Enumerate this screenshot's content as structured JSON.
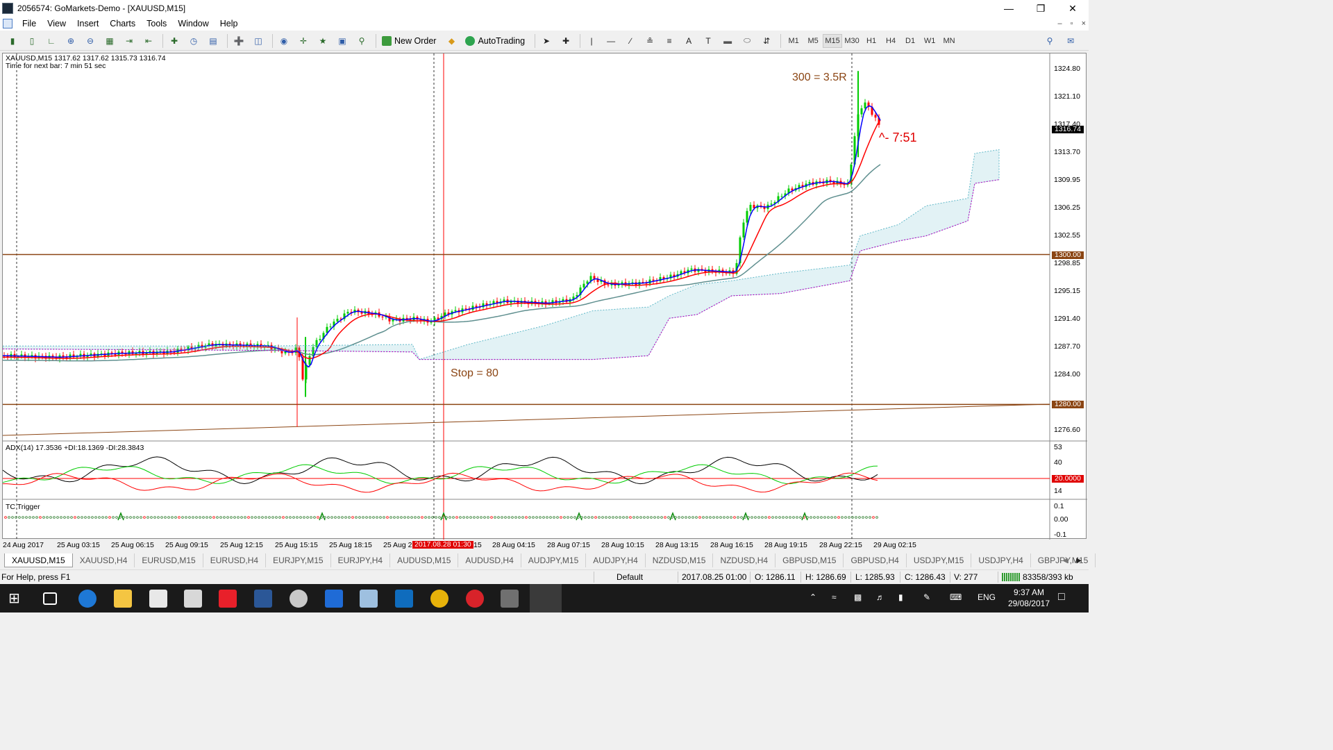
{
  "window": {
    "title": "2056574: GoMarkets-Demo - [XAUUSD,M15]",
    "minimize": "—",
    "restore": "❐",
    "close": "✕"
  },
  "menu": [
    "File",
    "Insert",
    "Charts",
    "Tools",
    "Window",
    "Help"
  ],
  "menu_view": "View",
  "toolbar": {
    "new_order": "New Order",
    "autotrading": "AutoTrading",
    "timeframes": [
      "M1",
      "M5",
      "M15",
      "M30",
      "H1",
      "H4",
      "D1",
      "W1",
      "MN"
    ],
    "active_timeframe": "M15"
  },
  "chart": {
    "info": "XAUUSD,M15  1317.62 1317.62 1315.73 1316.74",
    "timer": "Time for next bar: 7 min 51 sec",
    "annotation_target": "300 = 3.5R",
    "annotation_stop": "Stop = 80",
    "annotation_time": "^- 7:51",
    "current_price": "1316.74",
    "level_high": "1300.00",
    "level_low": "1280.00",
    "price_labels": [
      "1324.80",
      "1321.10",
      "1317.40",
      "1313.70",
      "1309.95",
      "1306.25",
      "1302.55",
      "1298.85",
      "1295.15",
      "1291.40",
      "1287.70",
      "1284.00",
      "1276.60"
    ],
    "time_labels": [
      "24 Aug 2017",
      "25 Aug 03:15",
      "25 Aug 06:15",
      "25 Aug 09:15",
      "25 Aug 12:15",
      "25 Aug 15:15",
      "25 Aug 18:15",
      "25 Aug 2",
      "15",
      "28 Aug 04:15",
      "28 Aug 07:15",
      "28 Aug 10:15",
      "28 Aug 13:15",
      "28 Aug 16:15",
      "28 Aug 19:15",
      "28 Aug 22:15",
      "29 Aug 02:15"
    ],
    "cursor_time": "2017.08.28 01:30",
    "colors": {
      "bull": "#00cc00",
      "bear": "#ff0000",
      "level": "#8b4513",
      "fast_ma": "#0000ff",
      "mid_ma": "#ff0000",
      "slow_ma": "#5f8f8f",
      "cloud": "#5fb8c8",
      "cloud_edge": "#c000c0"
    }
  },
  "adx": {
    "label": "ADX(14) 17.3536 +DI:18.1369 -DI:28.3843",
    "axis": [
      "53",
      "40",
      "14"
    ],
    "level": "20.0000"
  },
  "tc": {
    "label": "TC Trigger",
    "axis": [
      "0.1",
      "0.00",
      "-0.1"
    ]
  },
  "tabs": [
    "XAUUSD,M15",
    "XAUUSD,H4",
    "EURUSD,M15",
    "EURUSD,H4",
    "EURJPY,M15",
    "EURJPY,H4",
    "AUDUSD,M15",
    "AUDUSD,H4",
    "AUDJPY,M15",
    "AUDJPY,H4",
    "NZDUSD,M15",
    "NZDUSD,H4",
    "GBPUSD,M15",
    "GBPUSD,H4",
    "USDJPY,M15",
    "USDJPY,H4",
    "GBPJPY,M15"
  ],
  "status": {
    "help": "For Help, press F1",
    "profile": "Default",
    "datetime": "2017.08.25 01:00",
    "open": "O: 1286.11",
    "high": "H: 1286.69",
    "low": "L: 1285.93",
    "close": "C: 1286.43",
    "volume": "V: 277",
    "traffic": "83358/393 kb"
  },
  "taskbar": {
    "lang": "ENG",
    "time": "9:37 AM",
    "date": "29/08/2017"
  }
}
